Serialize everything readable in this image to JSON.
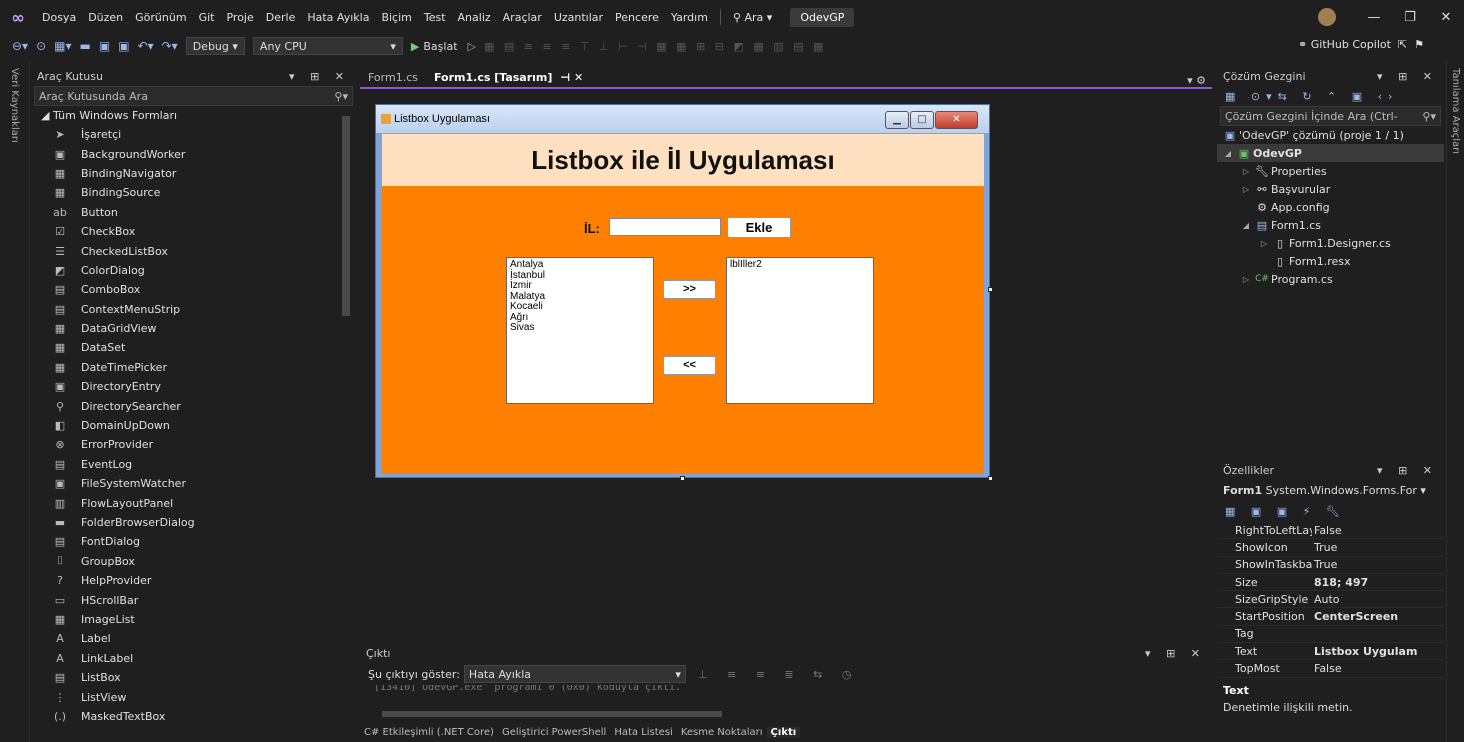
{
  "menubar": {
    "items": [
      "Dosya",
      "Düzen",
      "Görünüm",
      "Git",
      "Proje",
      "Derle",
      "Hata Ayıkla",
      "Biçim",
      "Test",
      "Analiz",
      "Araçlar",
      "Uzantılar",
      "Pencere",
      "Yardım"
    ],
    "search": "Ara",
    "project": "OdevGP"
  },
  "toolbar": {
    "config": "Debug",
    "platform": "Any CPU",
    "start": "Başlat",
    "copilot": "GitHub Copilot"
  },
  "leftstrip": "Veri Kaynakları",
  "rightstrip": "Tanılama Araçları",
  "toolbox": {
    "title": "Araç Kutusu",
    "search": "Araç Kutusunda Ara",
    "group": "Tüm Windows Formları",
    "items": [
      {
        "label": "İşaretçi",
        "icon": "pointer-icon",
        "glyph": "➤"
      },
      {
        "label": "BackgroundWorker",
        "icon": "backgroundworker-icon",
        "glyph": "▣"
      },
      {
        "label": "BindingNavigator",
        "icon": "bindingnavigator-icon",
        "glyph": "▦"
      },
      {
        "label": "BindingSource",
        "icon": "bindingsource-icon",
        "glyph": "▦"
      },
      {
        "label": "Button",
        "icon": "button-icon",
        "glyph": "ab"
      },
      {
        "label": "CheckBox",
        "icon": "checkbox-icon",
        "glyph": "☑"
      },
      {
        "label": "CheckedListBox",
        "icon": "checkedlistbox-icon",
        "glyph": "☰"
      },
      {
        "label": "ColorDialog",
        "icon": "colordialog-icon",
        "glyph": "◩"
      },
      {
        "label": "ComboBox",
        "icon": "combobox-icon",
        "glyph": "▤"
      },
      {
        "label": "ContextMenuStrip",
        "icon": "contextmenustrip-icon",
        "glyph": "▤"
      },
      {
        "label": "DataGridView",
        "icon": "datagridview-icon",
        "glyph": "▦"
      },
      {
        "label": "DataSet",
        "icon": "dataset-icon",
        "glyph": "▦"
      },
      {
        "label": "DateTimePicker",
        "icon": "datetimepicker-icon",
        "glyph": "▦"
      },
      {
        "label": "DirectoryEntry",
        "icon": "directoryentry-icon",
        "glyph": "▣"
      },
      {
        "label": "DirectorySearcher",
        "icon": "directorysearcher-icon",
        "glyph": "⚲"
      },
      {
        "label": "DomainUpDown",
        "icon": "domainupdown-icon",
        "glyph": "◧"
      },
      {
        "label": "ErrorProvider",
        "icon": "errorprovider-icon",
        "glyph": "⊗"
      },
      {
        "label": "EventLog",
        "icon": "eventlog-icon",
        "glyph": "▤"
      },
      {
        "label": "FileSystemWatcher",
        "icon": "filesystemwatcher-icon",
        "glyph": "▣"
      },
      {
        "label": "FlowLayoutPanel",
        "icon": "flowlayoutpanel-icon",
        "glyph": "▥"
      },
      {
        "label": "FolderBrowserDialog",
        "icon": "folderbrowserdialog-icon",
        "glyph": "▬"
      },
      {
        "label": "FontDialog",
        "icon": "fontdialog-icon",
        "glyph": "▤"
      },
      {
        "label": "GroupBox",
        "icon": "groupbox-icon",
        "glyph": "⌷"
      },
      {
        "label": "HelpProvider",
        "icon": "helpprovider-icon",
        "glyph": "?"
      },
      {
        "label": "HScrollBar",
        "icon": "hscrollbar-icon",
        "glyph": "▭"
      },
      {
        "label": "ImageList",
        "icon": "imagelist-icon",
        "glyph": "▦"
      },
      {
        "label": "Label",
        "icon": "label-icon",
        "glyph": "A"
      },
      {
        "label": "LinkLabel",
        "icon": "linklabel-icon",
        "glyph": "A"
      },
      {
        "label": "ListBox",
        "icon": "listbox-icon",
        "glyph": "▤"
      },
      {
        "label": "ListView",
        "icon": "listview-icon",
        "glyph": "⋮"
      },
      {
        "label": "MaskedTextBox",
        "icon": "maskedtextbox-icon",
        "glyph": "(.)"
      }
    ]
  },
  "editor": {
    "tabs": [
      {
        "label": "Form1.cs",
        "active": false
      },
      {
        "label": "Form1.cs [Tasarım]",
        "active": true
      }
    ]
  },
  "form": {
    "title": "Listbox Uygulaması",
    "header": "Listbox ile İl Uygulaması",
    "il_label": "İL:",
    "add_button": "Ekle",
    "move_right": ">>",
    "move_left": "<<",
    "left_list": [
      "Antalya",
      "İstanbul",
      "İzmir",
      "Malatya",
      "Kocaeli",
      "Ağrı",
      "Sivas"
    ],
    "right_list_name": "lblIller2"
  },
  "solution": {
    "title": "Çözüm Gezgini",
    "search": "Çözüm Gezgini İçinde Ara (Ctrl-",
    "solution_line": "'OdevGP' çözümü (proje 1 / 1)",
    "project": "OdevGP",
    "items": [
      "Properties",
      "Başvurular",
      "App.config",
      "Form1.cs",
      "Form1.Designer.cs",
      "Form1.resx",
      "Program.cs"
    ]
  },
  "properties": {
    "title": "Özellikler",
    "object": "Form1",
    "object_type": "System.Windows.Forms.For",
    "rows": [
      {
        "name": "RightToLeftLayo",
        "value": "False",
        "bold": false
      },
      {
        "name": "ShowIcon",
        "value": "True",
        "bold": false
      },
      {
        "name": "ShowInTaskbar",
        "value": "True",
        "bold": false
      },
      {
        "name": "Size",
        "value": "818; 497",
        "bold": true
      },
      {
        "name": "SizeGripStyle",
        "value": "Auto",
        "bold": false
      },
      {
        "name": "StartPosition",
        "value": "CenterScreen",
        "bold": true
      },
      {
        "name": "Tag",
        "value": "",
        "bold": false
      },
      {
        "name": "Text",
        "value": "Listbox Uygulam",
        "bold": true
      },
      {
        "name": "TopMost",
        "value": "False",
        "bold": false
      }
    ],
    "desc_title": "Text",
    "desc_text": "Denetimle ilişkili metin."
  },
  "output": {
    "title": "Çıktı",
    "show_label": "Şu çıktıyı göster:",
    "source": "Hata Ayıkla",
    "line": "[13410] OdevGP.exe' programı 0 (0x0) koduyla çıktı."
  },
  "bottom_tabs": [
    "C# Etkileşimli (.NET Core)",
    "Geliştirici PowerShell",
    "Hata Listesi",
    "Kesme Noktaları",
    "Çıktı"
  ]
}
